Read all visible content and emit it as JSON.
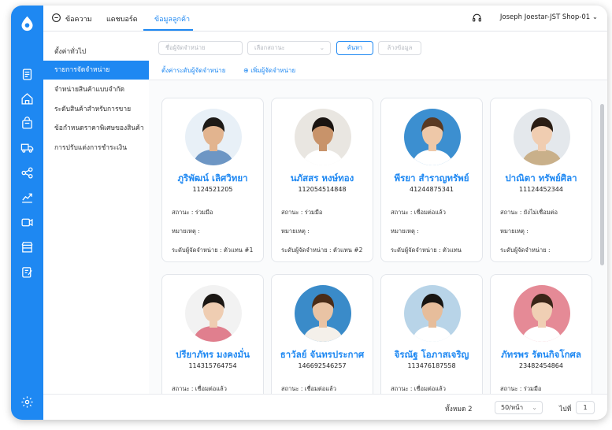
{
  "topbar": {
    "tabs": [
      {
        "label": "ข้อความ"
      },
      {
        "label": "แดชบอร์ด"
      },
      {
        "label": "ข้อมูลลูกค้า"
      }
    ],
    "user": "Joseph Joestar-JST Shop-01"
  },
  "sidebar": {
    "items": [
      {
        "label": "ตั้งค่าทั่วไป"
      },
      {
        "label": "รายการจัดจำหน่าย"
      },
      {
        "label": "จำหน่ายสินค้าแบบจำกัด"
      },
      {
        "label": "ระดับสินค้าสำหรับการขาย"
      },
      {
        "label": "ข้อกำหนดราคาพิเศษของสินค้า"
      },
      {
        "label": "การปรับแต่งการชำระเงิน"
      }
    ]
  },
  "filter": {
    "name_placeholder": "ชื่อผู้จัดจำหน่าย",
    "status_placeholder": "เลือกสถานะ",
    "search_label": "ค้นหา",
    "clear_label": "ล้างข้อมูล",
    "level_link": "ตั้งค่าระดับผู้จัดจำหน่าย",
    "add_link": "เพิ่มผู้จัดจำหน่าย"
  },
  "labels": {
    "status": "สถานะ :",
    "note": "หมายเหตุ :",
    "level": "ระดับผู้จัดจำหน่าย :"
  },
  "cards": [
    {
      "name": "ภูริพัฒน์ เลิศวิทยา",
      "code": "1124521205",
      "status": "ร่วมมือ",
      "note": "",
      "level": "ตัวแทน #1",
      "skin": "#e2b48f",
      "hair": "#1d1a17",
      "bg": "#e8f0f7",
      "shirt": "#6d96c4"
    },
    {
      "name": "นภัสสร หงษ์ทอง",
      "code": "112054514848",
      "status": "ร่วมมือ",
      "note": "",
      "level": "ตัวแทน #2",
      "skin": "#c8936a",
      "hair": "#1a1411",
      "bg": "#e9e6e1",
      "shirt": "#ffffff"
    },
    {
      "name": "พีรยา สำราญทรัพย์",
      "code": "41244875341",
      "status": "เชื่อมต่อแล้ว",
      "note": "",
      "level": "ตัวแทน",
      "skin": "#eec8a8",
      "hair": "#5a3a22",
      "bg": "#3c8fd0",
      "shirt": "#ffffff"
    },
    {
      "name": "ปาณิตา ทรัพย์ศิลา",
      "code": "11124452344",
      "status": "ยังไม่เชื่อมต่อ",
      "note": "",
      "level": "",
      "skin": "#f0cdb1",
      "hair": "#2a1d14",
      "bg": "#e4e8ec",
      "shirt": "#c9b08a"
    },
    {
      "name": "ปรียาภัทร มงคงมั่น",
      "code": "114315764754",
      "status": "เชื่อมต่อแล้ว",
      "note": "",
      "level": "",
      "skin": "#efcdb2",
      "hair": "#1b1714",
      "bg": "#f2f2f2",
      "shirt": "#e07f8e"
    },
    {
      "name": "ธาวัลย์ จันทรประกาศ",
      "code": "146692546257",
      "status": "เชื่อมต่อแล้ว",
      "note": "",
      "level": "",
      "skin": "#e9c3a4",
      "hair": "#4a2c18",
      "bg": "#3a8bc9",
      "shirt": "#f4f0ea"
    },
    {
      "name": "จิรณัฐ โอภาสเจริญ",
      "code": "113476187558",
      "status": "เชื่อมต่อแล้ว",
      "note": "",
      "level": "",
      "skin": "#e6bd9b",
      "hair": "#181512",
      "bg": "#b8d4e8",
      "shirt": "#ffffff"
    },
    {
      "name": "ภัทรพร รัตนกิจโกศล",
      "code": "23482454864",
      "status": "ร่วมมือ",
      "note": "",
      "level": "",
      "skin": "#f0cfb4",
      "hair": "#3a2518",
      "bg": "#e58a96",
      "shirt": "#ffffff"
    }
  ],
  "footer": {
    "total": "ทั้งหมด 2",
    "per_page": "50/หน้า",
    "goto": "ไปที่",
    "page": "1"
  },
  "colors": {
    "accent": "#1e88f2"
  },
  "icons": [
    "logo-icon",
    "document-icon",
    "home-icon",
    "bag-icon",
    "truck-icon",
    "share-icon",
    "chart-icon",
    "video-icon",
    "store-icon",
    "edit-icon",
    "settings-icon",
    "chat-icon",
    "headset-icon",
    "chevron-down-icon",
    "plus-circle-icon"
  ]
}
